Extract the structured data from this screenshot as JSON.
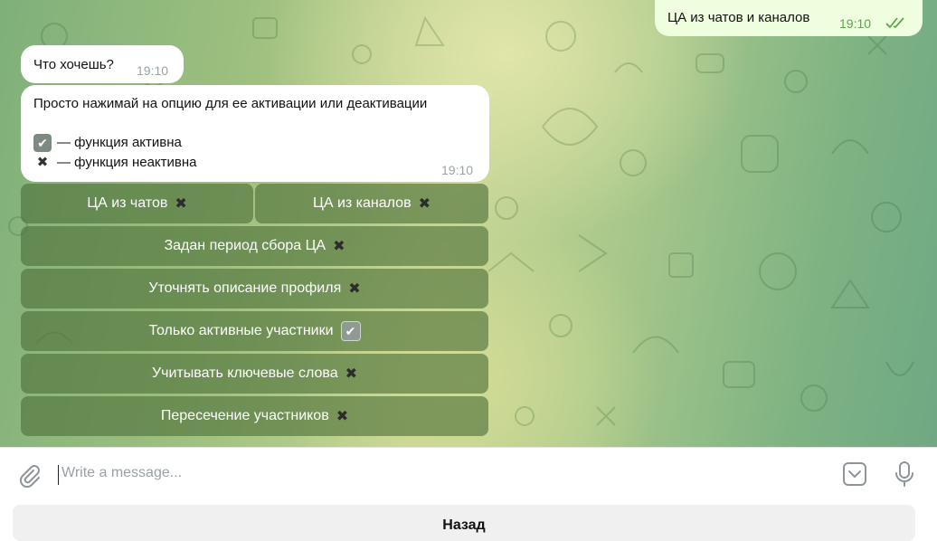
{
  "messages": {
    "outgoing": {
      "text": "ЦА из чатов и каналов",
      "time": "19:10",
      "status_icon": "double-check-icon"
    },
    "question": {
      "text": "Что хочешь?",
      "time": "19:10"
    },
    "instructions": {
      "text": "Просто нажимай на опцию для ее активации или деактивации",
      "active_legend": "— функция активна",
      "inactive_legend": "— функция неактивна",
      "time": "19:10"
    }
  },
  "inline_buttons": [
    {
      "label": "ЦА из чатов",
      "state": "inactive"
    },
    {
      "label": "ЦА из каналов",
      "state": "inactive"
    },
    {
      "label": "Задан период сбора ЦА",
      "state": "inactive"
    },
    {
      "label": "Уточнять описание профиля",
      "state": "inactive"
    },
    {
      "label": "Только активные участники",
      "state": "active"
    },
    {
      "label": "Учитывать ключевые слова",
      "state": "inactive"
    },
    {
      "label": "Пересечение участников",
      "state": "inactive"
    }
  ],
  "symbols": {
    "cross": "✖",
    "check": "✔"
  },
  "composer": {
    "placeholder": "Write a message..."
  },
  "keyboard": {
    "back_label": "Назад"
  },
  "colors": {
    "outgoing_bubble": "#eefedf",
    "inline_button": "#4e7038",
    "read_check": "#5fa34d"
  }
}
